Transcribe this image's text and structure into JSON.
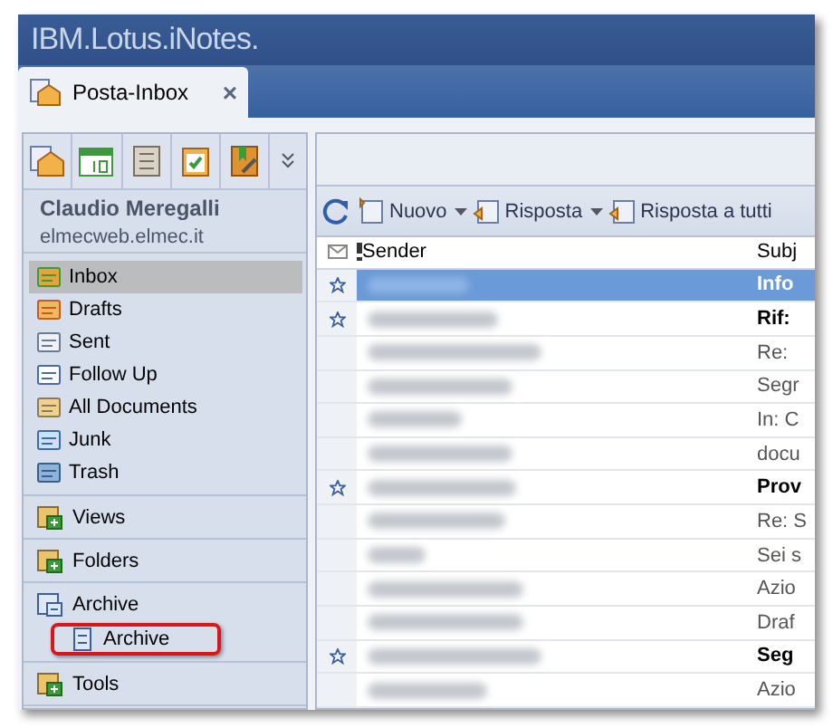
{
  "app_title": "IBM.Lotus.iNotes.",
  "tabs": [
    {
      "label": "Posta-Inbox",
      "close": "×",
      "selected": true
    }
  ],
  "account": {
    "name": "Claudio Meregalli",
    "server": "elmecweb.elmec.it"
  },
  "nav": [
    {
      "label": "Inbox",
      "selected": true
    },
    {
      "label": "Drafts",
      "selected": false
    },
    {
      "label": "Sent",
      "selected": false
    },
    {
      "label": "Follow Up",
      "selected": false
    },
    {
      "label": "All Documents",
      "selected": false
    },
    {
      "label": "Junk",
      "selected": false
    },
    {
      "label": "Trash",
      "selected": false
    }
  ],
  "sections": [
    {
      "label": "Views",
      "expanded": false
    },
    {
      "label": "Folders",
      "expanded": false
    },
    {
      "label": "Archive",
      "expanded": true,
      "children": [
        {
          "label": "Archive",
          "highlighted": true
        }
      ]
    },
    {
      "label": "Tools",
      "expanded": false
    }
  ],
  "toolbar": [
    {
      "label": "Nuovo",
      "dropdown": true
    },
    {
      "label": "Risposta",
      "dropdown": true
    },
    {
      "label": "Risposta a tutti",
      "dropdown": false
    }
  ],
  "columns": {
    "sender": "Sender",
    "subject": "Subj"
  },
  "rows": [
    {
      "subject": "Info",
      "starred": true,
      "unread": true,
      "selected": true
    },
    {
      "subject": "Rif:",
      "starred": true,
      "unread": true,
      "selected": false
    },
    {
      "subject": "Re:",
      "starred": false,
      "unread": false,
      "selected": false
    },
    {
      "subject": "Segr",
      "starred": false,
      "unread": false,
      "selected": false
    },
    {
      "subject": "In: C",
      "starred": false,
      "unread": false,
      "selected": false
    },
    {
      "subject": "docu",
      "starred": false,
      "unread": false,
      "selected": false
    },
    {
      "subject": "Prov",
      "starred": true,
      "unread": true,
      "selected": false
    },
    {
      "subject": "Re: S",
      "starred": false,
      "unread": false,
      "selected": false
    },
    {
      "subject": "Sei s",
      "starred": false,
      "unread": false,
      "selected": false
    },
    {
      "subject": "Azio",
      "starred": false,
      "unread": false,
      "selected": false
    },
    {
      "subject": "Draf",
      "starred": false,
      "unread": false,
      "selected": false
    },
    {
      "subject": "Seg",
      "starred": true,
      "unread": true,
      "selected": false
    },
    {
      "subject": "Azio",
      "starred": false,
      "unread": false,
      "selected": false
    }
  ]
}
